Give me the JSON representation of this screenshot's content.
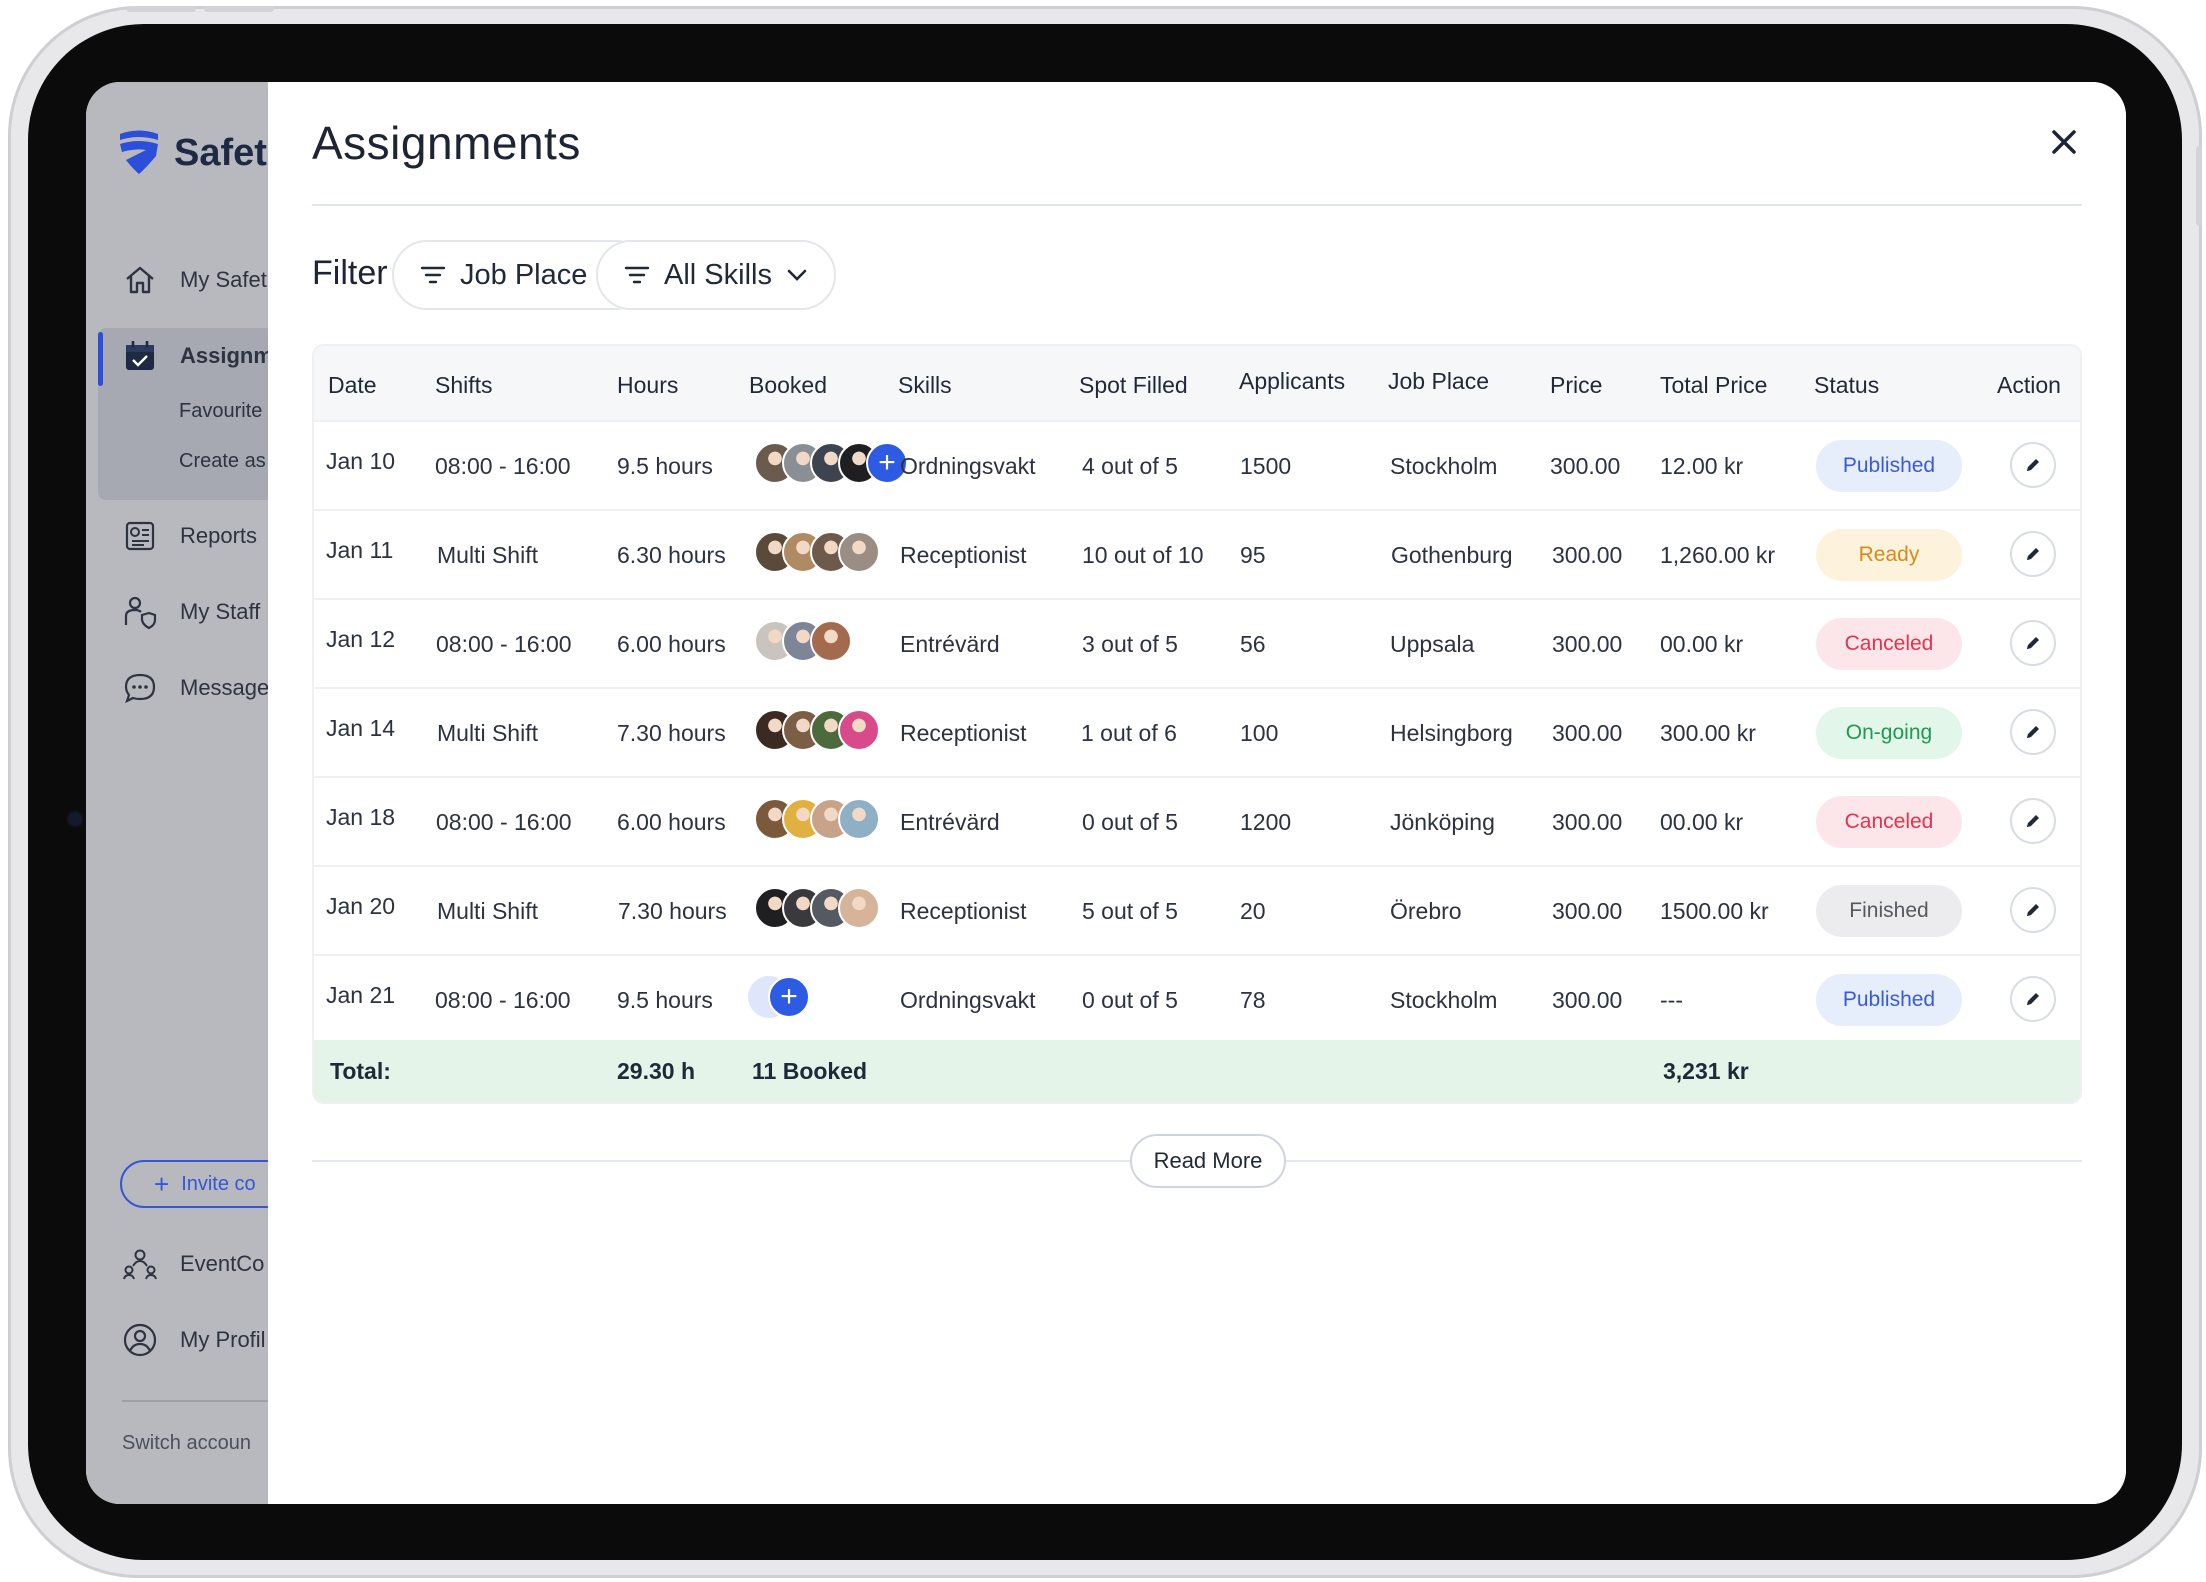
{
  "sidebar": {
    "logo_text": "Safetl",
    "items": [
      {
        "label": "My Safet",
        "icon": "home-icon"
      },
      {
        "label": "Assignm",
        "icon": "calendar-check-icon"
      },
      {
        "label": "Reports",
        "icon": "report-icon"
      },
      {
        "label": "My Staff",
        "icon": "staff-shield-icon"
      },
      {
        "label": "Message",
        "icon": "chat-icon"
      },
      {
        "label": "EventCo",
        "icon": "team-icon"
      },
      {
        "label": "My Profil",
        "icon": "user-circle-icon"
      }
    ],
    "sub_items": [
      "Favourite",
      "Create as"
    ],
    "invite_label": "Invite co",
    "switch_account": "Switch accoun"
  },
  "modal": {
    "title": "Assignments",
    "filter_label": "Filter",
    "filters": [
      {
        "label": "Job Place"
      },
      {
        "label": "All Skills"
      }
    ],
    "columns": [
      "Date",
      "Shifts",
      "Hours",
      "Booked",
      "Skills",
      "Spot Filled",
      "Applicants",
      "Job Place",
      "Price",
      "Total Price",
      "Status",
      "Action"
    ],
    "rows": [
      {
        "date": "Jan 10",
        "shift": "08:00 - 16:00",
        "hours": "9.5 hours",
        "skill": "Ordningsvakt",
        "spot": "4 out of 5",
        "applicants": "1500",
        "place": "Stockholm",
        "price": "300.00",
        "total": "12.00 kr",
        "status": "Published"
      },
      {
        "date": "Jan 11",
        "shift": "Multi Shift",
        "hours": "6.30 hours",
        "skill": "Receptionist",
        "spot": "10 out of 10",
        "applicants": "95",
        "place": "Gothenburg",
        "price": "300.00",
        "total": "1,260.00 kr",
        "status": "Ready"
      },
      {
        "date": "Jan 12",
        "shift": "08:00 - 16:00",
        "hours": "6.00 hours",
        "skill": "Entrévärd",
        "spot": "3 out of 5",
        "applicants": "56",
        "place": "Uppsala",
        "price": "300.00",
        "total": "00.00 kr",
        "status": "Canceled"
      },
      {
        "date": "Jan 14",
        "shift": "Multi Shift",
        "hours": "7.30 hours",
        "skill": "Receptionist",
        "spot": "1 out of 6",
        "applicants": "100",
        "place": "Helsingborg",
        "price": "300.00",
        "total": "300.00 kr",
        "status": "On-going"
      },
      {
        "date": "Jan 18",
        "shift": "08:00 - 16:00",
        "hours": "6.00 hours",
        "skill": "Entrévärd",
        "spot": "0 out of 5",
        "applicants": "1200",
        "place": "Jönköping",
        "price": "300.00",
        "total": "00.00 kr",
        "status": "Canceled"
      },
      {
        "date": "Jan 20",
        "shift": "Multi Shift",
        "hours": "7.30 hours",
        "skill": "Receptionist",
        "spot": "5 out of 5",
        "applicants": "20",
        "place": "Örebro",
        "price": "300.00",
        "total": "1500.00 kr",
        "status": "Finished"
      },
      {
        "date": "Jan 21",
        "shift": "08:00 - 16:00",
        "hours": "9.5 hours",
        "skill": "Ordningsvakt",
        "spot": "0 out of 5",
        "applicants": "78",
        "place": "Stockholm",
        "price": "300.00",
        "total": "---",
        "status": "Published"
      }
    ],
    "total": {
      "label": "Total:",
      "hours": "29.30 h",
      "booked": "11 Booked",
      "price": "3,231 kr"
    },
    "read_more": "Read More"
  },
  "status_colors": {
    "Published": {
      "bg": "#e6edfb",
      "fg": "#3b5bd6"
    },
    "Ready": {
      "bg": "#fdf3dc",
      "fg": "#d98a1a"
    },
    "Canceled": {
      "bg": "#fde6ea",
      "fg": "#e0344f"
    },
    "On-going": {
      "bg": "#e2f6ea",
      "fg": "#1f9a4f"
    },
    "Finished": {
      "bg": "#ececee",
      "fg": "#55595f"
    }
  },
  "accent_color": "#2d5be3"
}
